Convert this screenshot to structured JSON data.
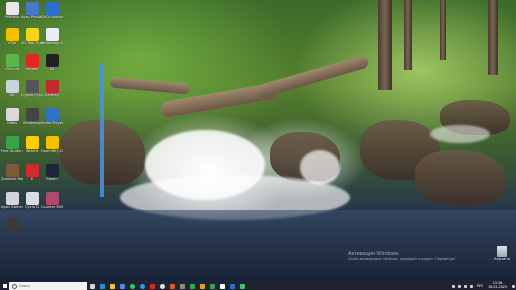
{
  "desktop": {
    "icons": [
      {
        "label": "Portfolio",
        "icon": "app-icon",
        "color": "#e8e8e8"
      },
      {
        "label": "Ayan Photo Composer",
        "icon": "app-icon",
        "color": "#4a78c8"
      },
      {
        "label": "DVD Uninstaller",
        "icon": "app-icon",
        "color": "#2a6fd1"
      },
      {
        "label": "uTile",
        "icon": "app-icon",
        "color": "#f2c200"
      },
      {
        "label": "3D Tool Gravity",
        "icon": "app-icon",
        "color": "#f7d31a"
      },
      {
        "label": "WhatsApp Ustaw",
        "icon": "app-icon",
        "color": "#eaeef4"
      },
      {
        "label": "uTorrent",
        "icon": "app-icon",
        "color": "#5bb54a"
      },
      {
        "label": "Yandex",
        "icon": "yandex-icon",
        "color": "#e52620"
      },
      {
        "label": "X4",
        "icon": "app-icon",
        "color": "#222222"
      },
      {
        "label": "Mc",
        "icon": "app-icon",
        "color": "#c9d3dd"
      },
      {
        "label": "Crypto Cryptio",
        "icon": "app-icon",
        "color": "#555555"
      },
      {
        "label": "Bentley",
        "icon": "app-icon",
        "color": "#c02a2a"
      },
      {
        "label": "Gibbs",
        "icon": "app-icon",
        "color": "#d9d9d9"
      },
      {
        "label": "Whatsapp",
        "icon": "app-icon",
        "color": "#444444"
      },
      {
        "label": "Radio Player",
        "icon": "app-icon",
        "color": "#2e73c8"
      },
      {
        "label": "Free Studio Manager",
        "icon": "app-icon",
        "color": "#3aa34a"
      },
      {
        "label": "Wizard",
        "icon": "app-icon",
        "color": "#ffcc00"
      },
      {
        "label": "Geometry Dash Lite",
        "icon": "app-icon",
        "color": "#f2c200"
      },
      {
        "label": "Zombies Ratho",
        "icon": "app-icon",
        "color": "#7a5b3a"
      },
      {
        "label": "K",
        "icon": "app-icon",
        "color": "#d12b2b"
      },
      {
        "label": "Steam",
        "icon": "steam-icon",
        "color": "#1b2838"
      },
      {
        "label": "Ayan Gaming",
        "icon": "app-icon",
        "color": "#cfd5dc"
      },
      {
        "label": "Cyclo D",
        "icon": "app-icon",
        "color": "#d8dde3"
      },
      {
        "label": "Counter MOBILE",
        "icon": "app-icon",
        "color": "#b04a6a"
      },
      {
        "label": "",
        "icon": "app-icon",
        "color": "#3a3a3a"
      }
    ],
    "recycle_bin": {
      "label": "Корзина",
      "icon": "recycle-bin-icon"
    },
    "watermark": {
      "line1": "Активация Windows",
      "line2": "Чтобы активировать Windows, перейдите в раздел \"Параметры\"."
    }
  },
  "taskbar": {
    "search_placeholder": "Поиск",
    "apps": [
      {
        "icon": "task-view-icon",
        "color": "#cfd6df"
      },
      {
        "icon": "edge-icon",
        "color": "#2a8fd6"
      },
      {
        "icon": "explorer-icon",
        "color": "#f4c542"
      },
      {
        "icon": "store-icon",
        "color": "#4b8fe0"
      },
      {
        "icon": "whatsapp-icon",
        "color": "#25d366"
      },
      {
        "icon": "skype-icon",
        "color": "#2a9fe0"
      },
      {
        "icon": "yandex-icon",
        "color": "#e52620"
      },
      {
        "icon": "opera-icon",
        "color": "#e0e0e0"
      },
      {
        "icon": "photo-icon",
        "color": "#e05a2b"
      },
      {
        "icon": "app-icon",
        "color": "#8a8a8a"
      },
      {
        "icon": "app-icon",
        "color": "#35a852"
      },
      {
        "icon": "app-icon",
        "color": "#e8a020"
      },
      {
        "icon": "app-icon",
        "color": "#3fa34d"
      },
      {
        "icon": "app-icon",
        "color": "#ffffff"
      },
      {
        "icon": "app-icon",
        "color": "#2a6fd1"
      },
      {
        "icon": "app-icon",
        "color": "#3fc070"
      }
    ],
    "tray": {
      "language": "РУС",
      "time": "15:56",
      "date": "18.01.2025"
    }
  },
  "colors": {
    "taskbar_bg": "#1f2430",
    "accent_bar": "#4a90d9"
  }
}
